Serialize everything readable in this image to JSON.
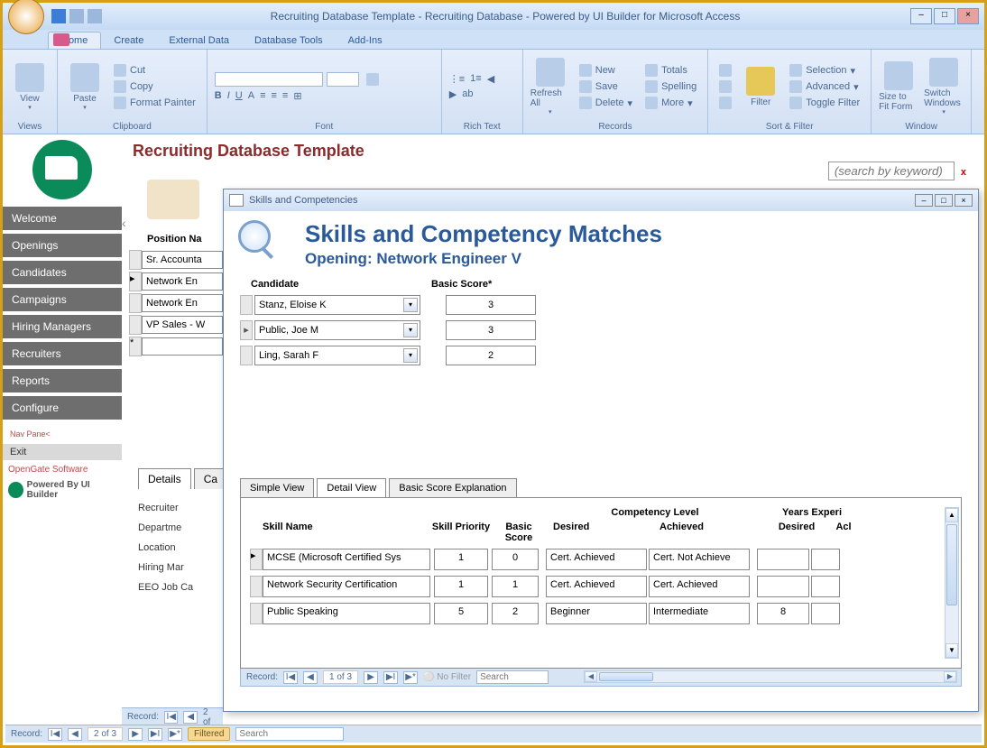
{
  "titlebar": {
    "title": "Recruiting Database Template - Recruiting Database - Powered by UI Builder for Microsoft Access"
  },
  "ribbon_tabs": [
    "Home",
    "Create",
    "External Data",
    "Database Tools",
    "Add-Ins"
  ],
  "ribbon_active": 0,
  "ribbon_groups": {
    "views": {
      "label": "Views",
      "btn": "View"
    },
    "clipboard": {
      "label": "Clipboard",
      "paste": "Paste",
      "cut": "Cut",
      "copy": "Copy",
      "fmt": "Format Painter"
    },
    "font": {
      "label": "Font"
    },
    "richtext": {
      "label": "Rich Text"
    },
    "records": {
      "label": "Records",
      "refresh": "Refresh All",
      "new": "New",
      "save": "Save",
      "delete": "Delete",
      "totals": "Totals",
      "spelling": "Spelling",
      "more": "More"
    },
    "sortfilter": {
      "label": "Sort & Filter",
      "filter": "Filter",
      "selection": "Selection",
      "advanced": "Advanced",
      "toggle": "Toggle Filter"
    },
    "window": {
      "label": "Window",
      "fit": "Size to Fit Form",
      "switch": "Switch Windows"
    }
  },
  "sidebar": {
    "items": [
      "Welcome",
      "Openings",
      "Candidates",
      "Campaigns",
      "Hiring Managers",
      "Recruiters",
      "Reports",
      "Configure"
    ],
    "navpane": "Nav Pane<",
    "exit": "Exit",
    "og": "OpenGate Software",
    "pb": "Powered By UI Builder"
  },
  "mainform": {
    "title": "Recruiting Database Template",
    "search_placeholder": "(search by keyword)",
    "positions_label": "Position Na",
    "positions": [
      "Sr. Accounta",
      "Network En",
      "Network En",
      "VP Sales - W"
    ],
    "detail_tab": "Details",
    "detail_tab2": "Ca",
    "field_labels": [
      "Recruiter",
      "Departme",
      "Location",
      "Hiring Mar",
      "EEO Job Ca"
    ]
  },
  "recnav_inner": {
    "label": "Record:",
    "pos": "2 of"
  },
  "recnav_outer": {
    "label": "Record:",
    "pos": "2 of 3",
    "filter": "Filtered",
    "search_ph": "Search"
  },
  "modal": {
    "title": "Skills and Competencies",
    "h1": "Skills and Competency Matches",
    "h2_lbl": "Opening:",
    "h2_val": "Network Engineer V",
    "cand_label": "Candidate",
    "score_label": "Basic Score*",
    "candidates": [
      {
        "name": "Stanz, Eloise K",
        "score": "3"
      },
      {
        "name": "Public, Joe M",
        "score": "3"
      },
      {
        "name": "Ling, Sarah F",
        "score": "2"
      }
    ],
    "active_row": 1,
    "tabs": [
      "Simple View",
      "Detail View",
      "Basic Score Explanation"
    ],
    "active_tab": 1,
    "skill_headers": {
      "name": "Skill Name",
      "priority": "Skill Priority",
      "score": "Basic Score",
      "comp": "Competency Level",
      "desired": "Desired",
      "achieved": "Achieved",
      "years": "Years Experi",
      "ydesired": "Desired",
      "yach": "Acl"
    },
    "skills": [
      {
        "name": "MCSE (Microsoft Certified Sys",
        "pri": "1",
        "score": "0",
        "des": "Cert. Achieved",
        "ach": "Cert. Not Achieve",
        "yd": "",
        "ya": ""
      },
      {
        "name": "Network Security Certification",
        "pri": "1",
        "score": "1",
        "des": "Cert. Achieved",
        "ach": "Cert. Achieved",
        "yd": "",
        "ya": ""
      },
      {
        "name": "Public Speaking",
        "pri": "5",
        "score": "2",
        "des": "Beginner",
        "ach": "Intermediate",
        "yd": "8",
        "ya": ""
      }
    ],
    "recnav": {
      "label": "Record:",
      "pos": "1 of 3",
      "nofilter": "No Filter",
      "search_ph": "Search"
    }
  }
}
